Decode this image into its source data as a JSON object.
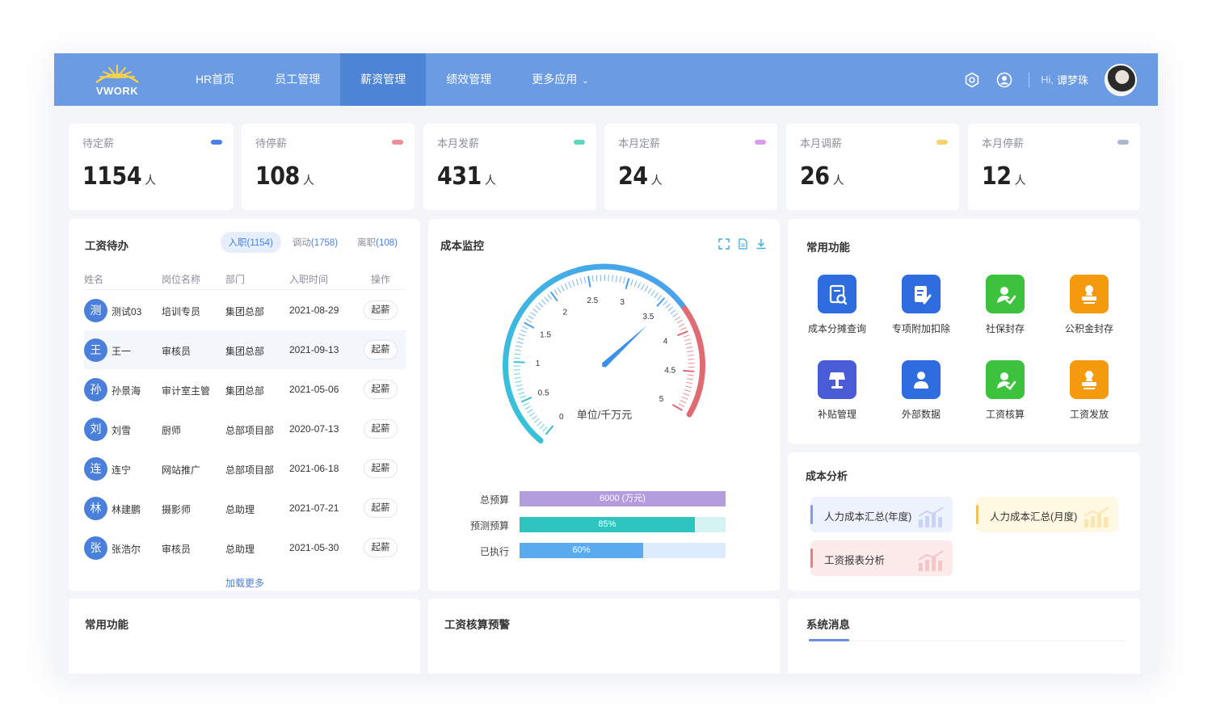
{
  "header": {
    "logo_text": "VWORK",
    "nav": [
      {
        "label": "HR首页"
      },
      {
        "label": "员工管理"
      },
      {
        "label": "薪资管理"
      },
      {
        "label": "绩效管理"
      },
      {
        "label": "更多应用"
      }
    ],
    "active_nav": "薪资管理",
    "greeting": "Hi,",
    "user_name": "谭梦珠"
  },
  "stats": [
    {
      "label": "待定薪",
      "value": "1154",
      "unit": "人",
      "color": "#4a80e8"
    },
    {
      "label": "待停薪",
      "value": "108",
      "unit": "人",
      "color": "#ef8e93"
    },
    {
      "label": "本月发薪",
      "value": "431",
      "unit": "人",
      "color": "#5fd6c2"
    },
    {
      "label": "本月定薪",
      "value": "24",
      "unit": "人",
      "color": "#d99cf0"
    },
    {
      "label": "本月调薪",
      "value": "26",
      "unit": "人",
      "color": "#f7cf6e"
    },
    {
      "label": "本月停薪",
      "value": "12",
      "unit": "人",
      "color": "#a9b7cc"
    }
  ],
  "payroll_todo": {
    "title": "工资待办",
    "tabs": [
      {
        "label": "入职",
        "count": "(1154)"
      },
      {
        "label": "调动",
        "count": "(1758)"
      },
      {
        "label": "离职",
        "count": "(108)"
      }
    ],
    "columns": [
      "姓名",
      "岗位名称",
      "部门",
      "入职时间",
      "操作"
    ],
    "rows": [
      {
        "initial": "测",
        "name": "测试03",
        "position": "培训专员",
        "dept": "集团总部",
        "date": "2021-08-29",
        "action": "起薪"
      },
      {
        "initial": "王",
        "name": "王一",
        "position": "审核员",
        "dept": "集团总部",
        "date": "2021-09-13",
        "action": "起薪"
      },
      {
        "initial": "孙",
        "name": "孙景海",
        "position": "审计室主管",
        "dept": "集团总部",
        "date": "2021-05-06",
        "action": "起薪"
      },
      {
        "initial": "刘",
        "name": "刘雪",
        "position": "厨师",
        "dept": "总部项目部",
        "date": "2020-07-13",
        "action": "起薪"
      },
      {
        "initial": "连",
        "name": "连宁",
        "position": "网站推广",
        "dept": "总部项目部",
        "date": "2021-06-18",
        "action": "起薪"
      },
      {
        "initial": "林",
        "name": "林建鹏",
        "position": "摄影师",
        "dept": "总助理",
        "date": "2021-07-21",
        "action": "起薪"
      },
      {
        "initial": "张",
        "name": "张浩尔",
        "position": "审核员",
        "dept": "总助理",
        "date": "2021-05-30",
        "action": "起薪"
      }
    ],
    "load_more": "加载更多"
  },
  "cost_monitor": {
    "title": "成本监控",
    "gauge": {
      "unit_label": "单位/千万元",
      "min": 0,
      "max": 5,
      "value": 3.6,
      "tick_labels": [
        "0",
        "0.5",
        "1",
        "1.5",
        "2",
        "2.5",
        "3",
        "3.5",
        "4",
        "4.5",
        "5"
      ]
    },
    "bars": [
      {
        "label": "总预算",
        "text": "6000 (万元)",
        "fraction": 1.0,
        "fill": "#b39ddc",
        "track": "#b39ddc"
      },
      {
        "label": "预测预算",
        "text": "85%",
        "fraction": 0.85,
        "fill": "#2ec4bf",
        "track": "#d4f3f2"
      },
      {
        "label": "已执行",
        "text": "60%",
        "fraction": 0.6,
        "fill": "#5aaaf0",
        "track": "#dcecfb"
      }
    ]
  },
  "common_functions": {
    "title": "常用功能",
    "items": [
      {
        "label": "成本分摊查询",
        "color": "#2d6de0",
        "icon": "search-doc-icon"
      },
      {
        "label": "专项附加扣除",
        "color": "#2d6de0",
        "icon": "edit-doc-icon"
      },
      {
        "label": "社保封存",
        "color": "#3cc23c",
        "icon": "user-check-icon"
      },
      {
        "label": "公积金封存",
        "color": "#f59a0c",
        "icon": "stamp-icon"
      },
      {
        "label": "补贴管理",
        "color": "#4a5bd6",
        "icon": "lamp-icon"
      },
      {
        "label": "外部数据",
        "color": "#2d6de0",
        "icon": "person-icon"
      },
      {
        "label": "工资核算",
        "color": "#3cc23c",
        "icon": "user-check-icon"
      },
      {
        "label": "工资发放",
        "color": "#f59a0c",
        "icon": "stamp-icon"
      }
    ]
  },
  "cost_analysis": {
    "title": "成本分析",
    "items": [
      {
        "label": "人力成本汇总(年度)",
        "bg": "#eef2fd",
        "bar": "#7c9ef0"
      },
      {
        "label": "人力成本汇总(月度)",
        "bg": "#fff8e3",
        "bar": "#f2c25a"
      },
      {
        "label": "工资报表分析",
        "bg": "#fdebec",
        "bar": "#ee7b80"
      }
    ]
  },
  "bottom": {
    "common_functions_title": "常用功能",
    "salary_warning_title": "工资核算预警",
    "system_messages_title": "系统消息"
  }
}
